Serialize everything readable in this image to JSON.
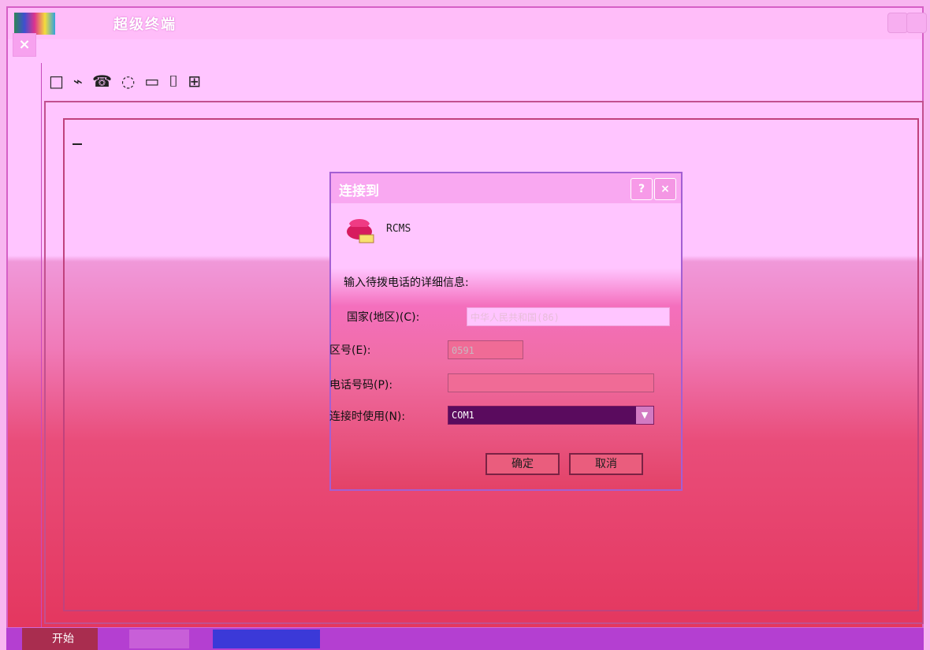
{
  "window": {
    "title": "超级终端"
  },
  "menu": [],
  "dialog": {
    "title": "连接到",
    "help_glyph": "?",
    "close_glyph": "×",
    "connection_name": "RCMS",
    "instruction": "输入待拨电话的详细信息:",
    "country_label": "国家(地区)(C):",
    "country_value": "中华人民共和国(86)",
    "area_label": "区号(E):",
    "area_value": "0591",
    "phone_label": "电话号码(P):",
    "phone_value": "",
    "device_label": "连接时使用(N):",
    "device_value": "COM1",
    "ok_label": "确定",
    "cancel_label": "取消"
  },
  "taskbar": {
    "start_label": "开始"
  }
}
